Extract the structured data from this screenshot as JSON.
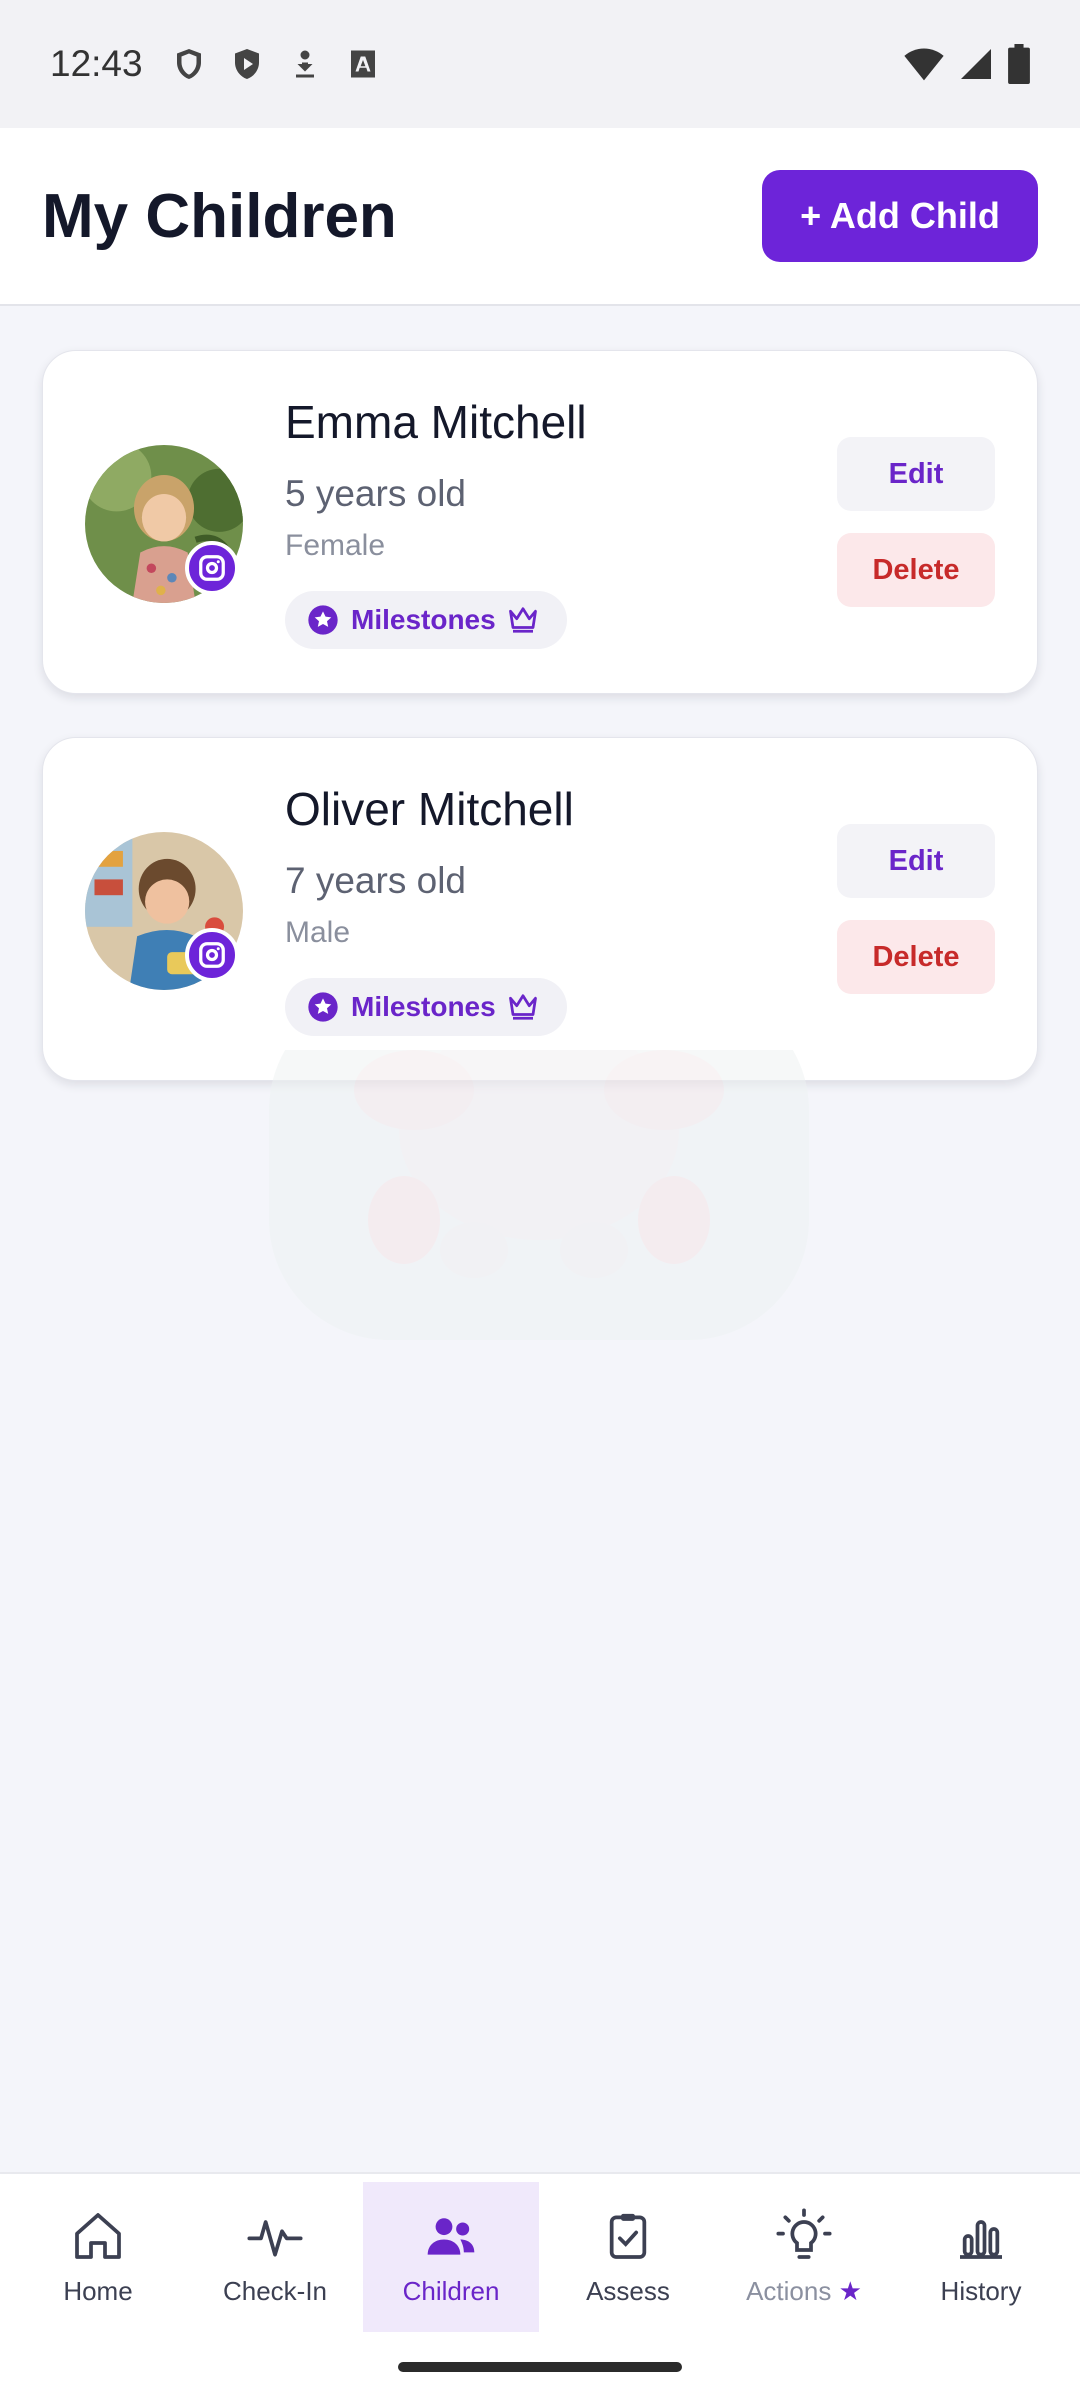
{
  "status_bar": {
    "time": "12:43",
    "icons_left": [
      "shield-icon",
      "play-shield-icon",
      "download-icon",
      "font-icon"
    ],
    "icons_right": [
      "wifi-icon",
      "signal-icon",
      "battery-icon"
    ]
  },
  "header": {
    "title": "My Children",
    "add_button_label": "+ Add Child"
  },
  "children": [
    {
      "name": "Emma Mitchell",
      "age": "5 years old",
      "gender": "Female",
      "milestones_label": "Milestones",
      "edit_label": "Edit",
      "delete_label": "Delete"
    },
    {
      "name": "Oliver Mitchell",
      "age": "7 years old",
      "gender": "Male",
      "milestones_label": "Milestones",
      "edit_label": "Edit",
      "delete_label": "Delete"
    }
  ],
  "bottom_nav": {
    "items": [
      {
        "label": "Home",
        "icon": "home-icon"
      },
      {
        "label": "Check-In",
        "icon": "pulse-icon"
      },
      {
        "label": "Children",
        "icon": "people-icon",
        "active": true
      },
      {
        "label": "Assess",
        "icon": "clipboard-check-icon"
      },
      {
        "label": "Actions",
        "icon": "lightbulb-icon",
        "badge_icon": "star-icon"
      },
      {
        "label": "History",
        "icon": "bar-chart-icon"
      }
    ]
  },
  "colors": {
    "accent": "#6d24d9",
    "accent_text": "#6a25c9",
    "delete_text": "#c72a2a",
    "delete_bg": "#fce8ea",
    "background": "#f4f5fa"
  }
}
